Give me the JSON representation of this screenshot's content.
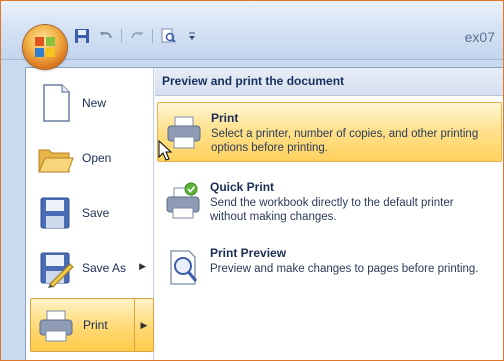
{
  "window": {
    "title": "ex07"
  },
  "quick_access": {
    "icons": [
      "save-icon",
      "undo-icon",
      "redo-icon",
      "print-preview-icon",
      "customize-icon"
    ]
  },
  "left_menu": {
    "items": [
      {
        "label": "New",
        "icon": "new-document-icon"
      },
      {
        "label": "Open",
        "icon": "open-folder-icon"
      },
      {
        "label": "Save",
        "icon": "save-icon"
      },
      {
        "label": "Save As",
        "icon": "save-as-icon",
        "has_submenu": true
      },
      {
        "label": "Print",
        "icon": "printer-icon",
        "has_submenu": true,
        "active": true
      }
    ]
  },
  "submenu": {
    "header": "Preview and print the document",
    "items": [
      {
        "title": "Print",
        "description": "Select a printer, number of copies, and other printing options before printing.",
        "icon": "printer-icon",
        "active": true
      },
      {
        "title": "Quick Print",
        "description": "Send the workbook directly to the default printer without making changes.",
        "icon": "quick-print-icon"
      },
      {
        "title": "Print Preview",
        "description": "Preview and make changes to pages before printing.",
        "icon": "print-preview-icon"
      }
    ]
  },
  "colors": {
    "highlight": "#ffd974",
    "frame": "#e0762a",
    "text": "#1b2d54"
  }
}
